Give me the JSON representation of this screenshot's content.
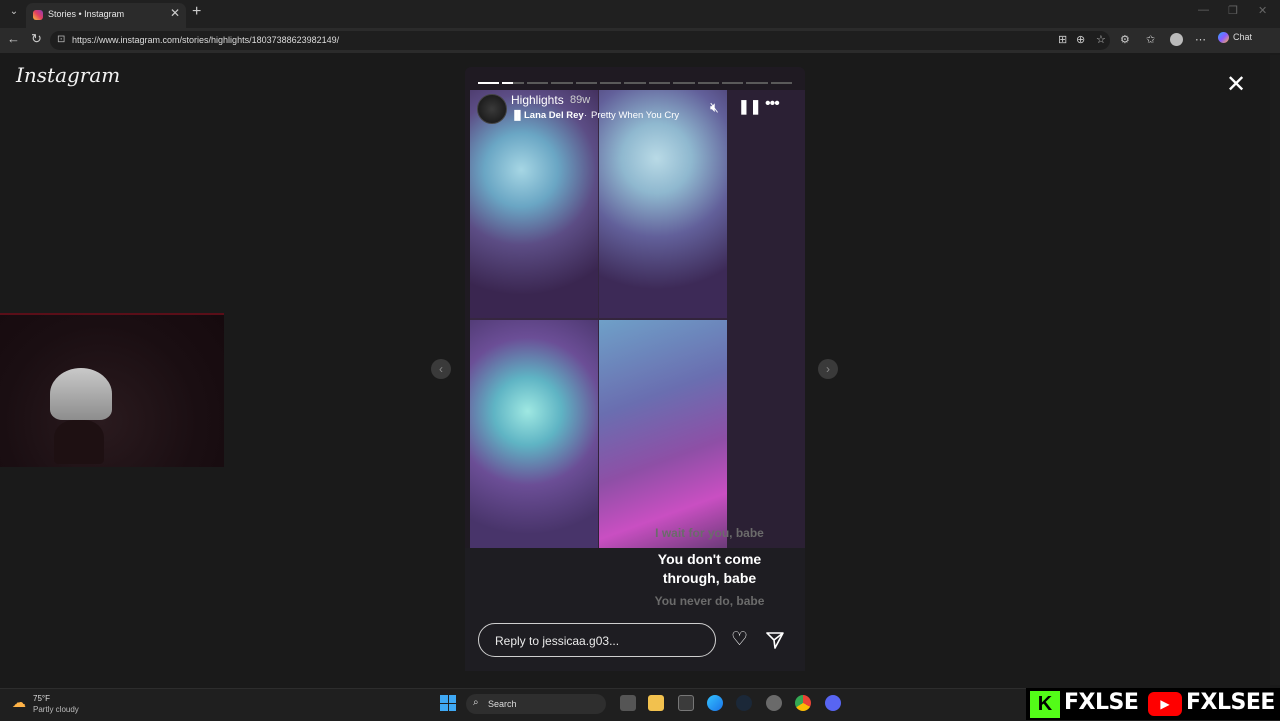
{
  "browser": {
    "tab_title": "Stories • Instagram",
    "tab_close": "✕",
    "new_tab": "+",
    "url": "https://www.instagram.com/stories/highlights/18037388623982149/",
    "chat_label": "Chat"
  },
  "page": {
    "logo": "Instagram",
    "close": "✕",
    "prev": "‹",
    "next": "›"
  },
  "story": {
    "progress_total": 13,
    "progress_current": 2,
    "highlight_name": "Highlights",
    "time_ago": "89w",
    "artist": "Lana Del Rey",
    "separator": "·",
    "song": "Pretty When You Cry",
    "lyrics": {
      "previous": "I wait for you, babe",
      "current_line1": "You don't come",
      "current_line2": "through, babe",
      "next": "You never do, babe"
    },
    "reply_placeholder": "Reply to jessicaa.g03..."
  },
  "taskbar": {
    "temperature": "75°F",
    "condition": "Partly cloudy",
    "search_label": "Search"
  },
  "brand": {
    "kick_letter": "K",
    "name1": "FXLSE",
    "yt_symbol": "▶",
    "name2": "FXLSEE"
  },
  "colors": {
    "kick": "#53fc18",
    "youtube": "#ff0000",
    "start": "#3fa9f5"
  }
}
